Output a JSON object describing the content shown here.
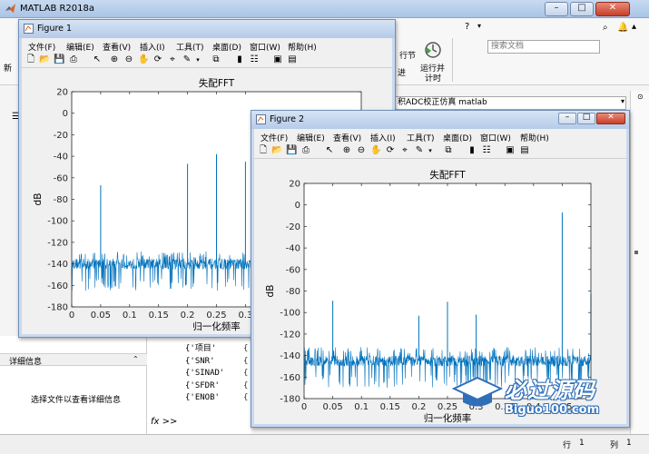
{
  "main_window": {
    "title": "MATLAB R2018a",
    "search_placeholder": "搜索文档",
    "toolbar_right": {
      "run_section_label": "行节",
      "advance_label": "进",
      "run_time_label_1": "运行并",
      "run_time_label_2": "计时"
    },
    "address": "积ADC校正仿真 matlab",
    "left_partial_char": "新",
    "details": {
      "header": "详细信息",
      "empty_text": "选择文件以查看详细信息"
    },
    "command_lines": [
      "{'项目'",
      "{'SNR'",
      "{'SINAD'",
      "{'SFDR'",
      "{'ENOB'"
    ],
    "command_cont": "{",
    "prompt": "fx >>",
    "status": {
      "row_label": "行",
      "row": "1",
      "col_label": "列",
      "col": "1"
    }
  },
  "figures": [
    {
      "title": "Figure 1",
      "menu": [
        "文件(F)",
        "编辑(E)",
        "查看(V)",
        "插入(I)",
        "工具(T)",
        "桌面(D)",
        "窗口(W)",
        "帮助(H)"
      ],
      "chart_data": {
        "type": "line",
        "title": "失配FFT",
        "xlabel": "归一化频率",
        "ylabel": "dB",
        "xlim": [
          0,
          0.5
        ],
        "ylim": [
          -180,
          20
        ],
        "xticks": [
          0,
          0.05,
          0.1,
          0.15,
          0.2,
          0.25,
          0.3
        ],
        "yticks": [
          20,
          0,
          -20,
          -40,
          -60,
          -80,
          -100,
          -120,
          -140,
          -160,
          -180
        ],
        "noise_floor": {
          "mean": -140,
          "low": -165,
          "high": -128
        },
        "spikes": [
          {
            "x": 0.05,
            "y": -67
          },
          {
            "x": 0.2,
            "y": -47
          },
          {
            "x": 0.25,
            "y": -38
          },
          {
            "x": 0.3,
            "y": -45
          }
        ],
        "color": "#0072bd"
      }
    },
    {
      "title": "Figure 2",
      "menu": [
        "文件(F)",
        "编辑(E)",
        "查看(V)",
        "插入(I)",
        "工具(T)",
        "桌面(D)",
        "窗口(W)",
        "帮助(H)"
      ],
      "chart_data": {
        "type": "line",
        "title": "失配FFT",
        "xlabel": "归一化频率",
        "ylabel": "dB",
        "xlim": [
          0,
          0.5
        ],
        "ylim": [
          -180,
          20
        ],
        "xticks": [
          0,
          0.05,
          0.1,
          0.15,
          0.2,
          0.25,
          0.3,
          0.35,
          0.4,
          0.45
        ],
        "yticks": [
          20,
          0,
          -20,
          -40,
          -60,
          -80,
          -100,
          -120,
          -140,
          -160,
          -180
        ],
        "noise_floor": {
          "mean": -145,
          "low": -170,
          "high": -132
        },
        "spikes": [
          {
            "x": 0.05,
            "y": -89
          },
          {
            "x": 0.2,
            "y": -103
          },
          {
            "x": 0.25,
            "y": -90
          },
          {
            "x": 0.3,
            "y": -102
          },
          {
            "x": 0.45,
            "y": -7
          },
          {
            "x": 0.5,
            "y": -83
          }
        ],
        "color": "#0072bd"
      }
    }
  ],
  "watermark": {
    "cn": "必过源码",
    "en": "Biguo100.com"
  }
}
